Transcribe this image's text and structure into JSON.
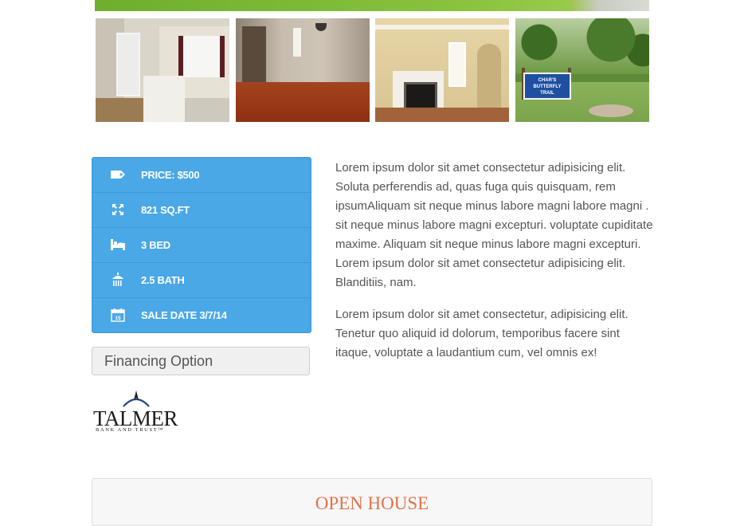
{
  "gallery": {
    "thumbnails": [
      {
        "name": "entry-room-photo"
      },
      {
        "name": "living-room-photo"
      },
      {
        "name": "fireplace-room-photo"
      },
      {
        "name": "butterfly-trail-photo",
        "sign_text": "CHAR'S BUTTERFLY TRAIL"
      }
    ]
  },
  "features": [
    {
      "icon": "price-tag-icon",
      "label": "PRICE: $500"
    },
    {
      "icon": "expand-arrows-icon",
      "label": "821 SQ.FT"
    },
    {
      "icon": "bed-icon",
      "label": "3 BED"
    },
    {
      "icon": "shower-icon",
      "label": "2.5 BATH"
    },
    {
      "icon": "calendar-icon",
      "label": "SALE DATE 3/7/14",
      "calendar_day": "15"
    }
  ],
  "financing": {
    "label": "Financing Option"
  },
  "logo": {
    "name": "TALMER",
    "tagline": "BANK AND TRUST™"
  },
  "description": {
    "paragraphs": [
      "Lorem ipsum dolor sit amet consectetur adipisicing elit. Soluta perferendis ad, quas fuga quis quisquam, rem ipsumAliquam sit neque minus labore magni labore magni . sit neque minus labore magni excepturi. voluptate cupiditate maxime. Aliquam sit neque minus labore magni excepturi. Lorem ipsum dolor sit amet consectetur adipisicing elit. Blanditiis, nam.",
      "Lorem ipsum dolor sit amet consectetur, adipisicing elit. Tenetur quo aliquid id dolorum, temporibus facere sint itaque, voluptate a laudantium cum, vel omnis ex!"
    ]
  },
  "open_house": {
    "title": "OPEN HOUSE"
  },
  "colors": {
    "panel_blue": "#4aa8e6",
    "accent_orange": "#e0724b",
    "text_gray": "#555555"
  }
}
